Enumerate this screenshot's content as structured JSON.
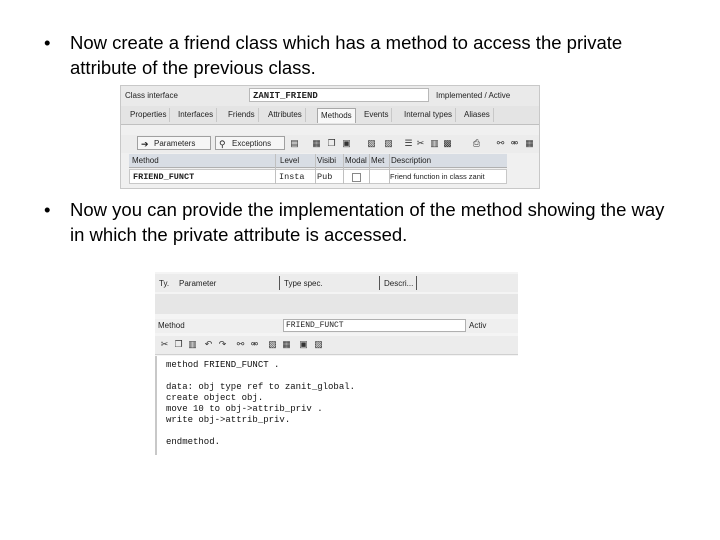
{
  "bullets": [
    {
      "marker": "•",
      "text": "Now create a friend class which has a method to access the private attribute of the previous class."
    },
    {
      "marker": "•",
      "text": "Now you can provide the implementation of the method showing the way in which the private attribute is accessed."
    }
  ],
  "screenshot1": {
    "class_label": "Class interface",
    "class_value": "ZANIT_FRIEND",
    "status": "Implemented / Active",
    "tabs": [
      "Properties",
      "Interfaces",
      "Friends",
      "Attributes",
      "Methods",
      "Events",
      "Internal types",
      "Aliases"
    ],
    "buttons": {
      "parameters": "Parameters",
      "exceptions": "Exceptions"
    },
    "columns": [
      "Method",
      "Level",
      "Visibi",
      "Modal",
      "Met",
      "Description"
    ],
    "row": {
      "method": "FRIEND_FUNCT",
      "level": "Insta",
      "visibility": "Pub",
      "description": "Friend function in class zanit"
    }
  },
  "screenshot2": {
    "headers": [
      "Ty.",
      "Parameter",
      "Type spec.",
      "Descri..."
    ],
    "method_label": "Method",
    "method_value": "FRIEND_FUNCT",
    "status": "Activ",
    "code": [
      "method FRIEND_FUNCT .",
      "",
      "data: obj type ref to zanit_global.",
      "create object obj.",
      "move 10 to obj->attrib_priv .",
      "write obj->attrib_priv.",
      "",
      "endmethod."
    ]
  }
}
